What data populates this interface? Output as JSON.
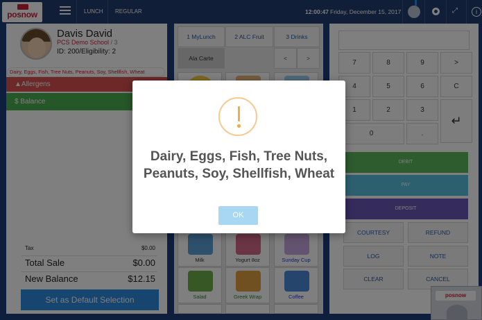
{
  "header": {
    "logo_text": "posnow",
    "nav": [
      "LUNCH",
      "REGULAR"
    ],
    "time": "12:00:47",
    "date": "Friday, December 15, 2017",
    "icons": [
      "user-icon",
      "gear-icon",
      "expand-icon",
      "info-icon"
    ],
    "info_glyph": "i"
  },
  "student": {
    "name": "Davis David",
    "school": "PCS Demo School",
    "school_suffix": " / 3",
    "id_line": "ID: 200/Eligibility: 2",
    "allergy_list": "Dairy, Eggs, Fish, Tree Nuts, Peanuts, Soy, Shellfish, Wheat",
    "allergens_label": "Allergens",
    "allergens_glyph": "▲",
    "balance_label": "$ Balance"
  },
  "summary": {
    "tax_label": "Tax",
    "tax_value": "$0.00",
    "total_label": "Total Sale",
    "total_value": "$0.00",
    "new_balance_label": "New Balance",
    "new_balance_value": "$12.15",
    "default_button": "Set as Default Selection"
  },
  "menu": {
    "tabs": [
      "1 MyLunch",
      "2 ALC Fruit",
      "3 Drinks",
      "Ala Carte",
      "<",
      ">"
    ],
    "items": [
      {
        "label": "Milk",
        "color": "#5aa0d8"
      },
      {
        "label": "Yogurt 8oz",
        "color": "#d46a8a"
      },
      {
        "label": "Sunday Cup",
        "color": "#c9a6e0"
      },
      {
        "label": "Salad",
        "color": "#6fb04a"
      },
      {
        "label": "Greek Wrap",
        "color": "#e0a040"
      },
      {
        "label": "Coffee",
        "color": "#4a8ad8"
      }
    ]
  },
  "keypad": {
    "keys": [
      "7",
      "8",
      "9",
      ">",
      "4",
      "5",
      "6",
      "C",
      "1",
      "2",
      "3",
      "0",
      "."
    ],
    "enter_glyph": "↵",
    "debit": "DEBIT",
    "pay": "PAY",
    "deposit": "DEPOSIT",
    "courtesy": "COURTESY",
    "refund": "REFUND",
    "log": "LOG",
    "note": "NOTE",
    "clear": "CLEAR",
    "cancel": "CANCEL"
  },
  "modal": {
    "message": "Dairy, Eggs, Fish, Tree Nuts, Peanuts, Soy, Shellfish, Wheat",
    "ok_label": "OK",
    "accent_color": "#f0ad4e"
  },
  "colors": {
    "brand_red": "#c7223a",
    "header_blue": "#203f6e",
    "primary_blue": "#2c8be0",
    "balance_green": "#4caf50",
    "allergen_red": "#d9534f"
  }
}
